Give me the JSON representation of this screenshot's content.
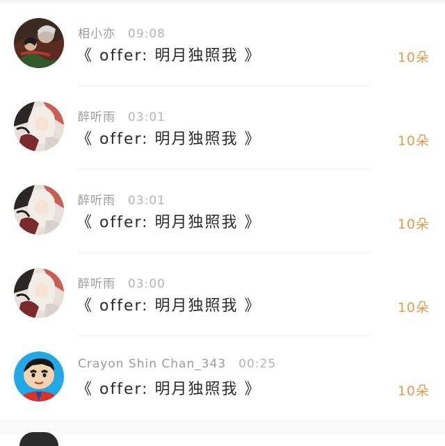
{
  "gift_list": {
    "items": [
      {
        "user": "相小亦",
        "time": "09:08",
        "gift": "《 offer: 明月独照我 》",
        "count": "10朵",
        "avatar_icon": "dark-anime-art-avatar-icon"
      },
      {
        "user": "醉听雨",
        "time": "03:01",
        "gift": "《 offer: 明月独照我 》",
        "count": "10朵",
        "avatar_icon": "white-hair-anime-avatar-icon"
      },
      {
        "user": "醉听雨",
        "time": "03:01",
        "gift": "《 offer: 明月独照我 》",
        "count": "10朵",
        "avatar_icon": "white-hair-anime-avatar-icon"
      },
      {
        "user": "醉听雨",
        "time": "03:00",
        "gift": "《 offer: 明月独照我 》",
        "count": "10朵",
        "avatar_icon": "white-hair-anime-avatar-icon"
      },
      {
        "user": "Crayon Shin Chan_343",
        "time": "00:25",
        "gift": "《 offer: 明月独照我 》",
        "count": "10朵",
        "avatar_icon": "crayon-shin-chan-avatar-icon"
      }
    ]
  },
  "colors": {
    "count_accent": "#e39a4c",
    "username_gray": "#9a9a9a",
    "text_dark": "#2a2a2a"
  }
}
